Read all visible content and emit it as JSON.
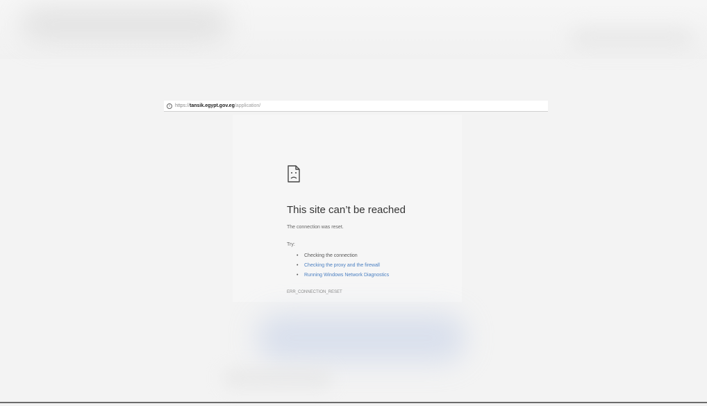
{
  "address_bar": {
    "scheme": "https://",
    "host": "tansik.egypt.gov.eg",
    "path": "/application/"
  },
  "icons": {
    "info": "info-icon",
    "sad_page": "sad-page-icon"
  },
  "error": {
    "title": "This site can’t be reached",
    "description": "The connection was reset.",
    "try_label": "Try:",
    "suggestions": [
      {
        "label": "Checking the connection",
        "is_link": false
      },
      {
        "label": "Checking the proxy and the firewall",
        "is_link": true
      },
      {
        "label": "Running Windows Network Diagnostics",
        "is_link": true
      }
    ],
    "code": "ERR_CONNECTION_RESET"
  },
  "colors": {
    "link": "#4a7fc1",
    "title": "#333333",
    "background": "#f3f3f3"
  }
}
